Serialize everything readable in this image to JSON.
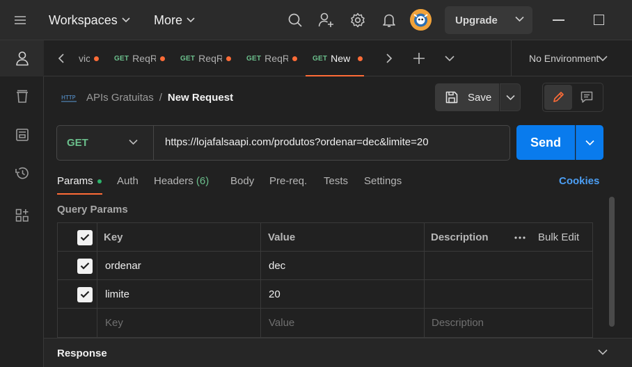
{
  "topbar": {
    "workspaces_label": "Workspaces",
    "more_label": "More",
    "upgrade_label": "Upgrade"
  },
  "tabs": [
    {
      "method": "",
      "name": "vic"
    },
    {
      "method": "GET",
      "name": "ReqR"
    },
    {
      "method": "GET",
      "name": "ReqR"
    },
    {
      "method": "GET",
      "name": "ReqR"
    },
    {
      "method": "GET",
      "name": "New"
    }
  ],
  "environment": "No Environment",
  "breadcrumb": {
    "icon_text": "HTTP",
    "collection": "APIs Gratuitas",
    "separator": "/",
    "request": "New Request"
  },
  "save_label": "Save",
  "request": {
    "method": "GET",
    "url": "https://lojafalsaapi.com/produtos?ordenar=dec&limite=20"
  },
  "send_label": "Send",
  "request_tabs": {
    "params": "Params",
    "auth": "Auth",
    "headers": "Headers",
    "headers_count": "(6)",
    "body": "Body",
    "prereq": "Pre-req.",
    "tests": "Tests",
    "settings": "Settings"
  },
  "cookies_label": "Cookies",
  "query_params_title": "Query Params",
  "table": {
    "headers": {
      "key": "Key",
      "value": "Value",
      "description": "Description",
      "bulk_edit": "Bulk Edit"
    },
    "rows": [
      {
        "key": "ordenar",
        "value": "dec",
        "description": ""
      },
      {
        "key": "limite",
        "value": "20",
        "description": ""
      }
    ],
    "placeholders": {
      "key": "Key",
      "value": "Value",
      "description": "Description"
    }
  },
  "response_label": "Response",
  "colors": {
    "accent": "#ff6c37",
    "send": "#097bed",
    "get_method": "#6bbf8c",
    "link": "#4c9ff5"
  }
}
